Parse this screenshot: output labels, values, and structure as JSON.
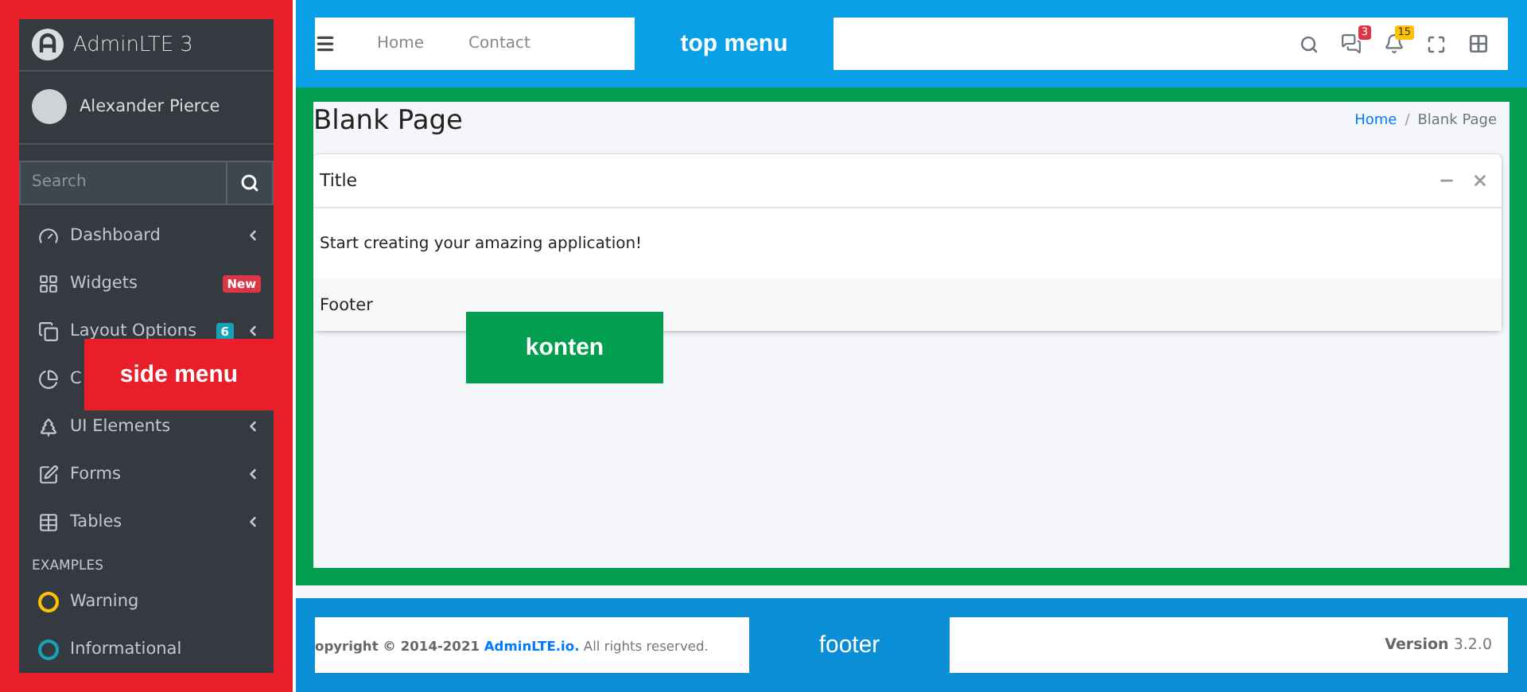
{
  "sidebar": {
    "brand": "AdminLTE 3",
    "user": "Alexander Pierce",
    "search": {
      "placeholder": "Search"
    },
    "items": [
      {
        "label": "Dashboard",
        "arrow": true
      },
      {
        "label": "Widgets",
        "arrow": false,
        "badge": {
          "text": "New",
          "color": "#dc3545"
        }
      },
      {
        "label": "Layout Options",
        "arrow": true,
        "badge": {
          "text": "6",
          "color": "#17a2b8"
        }
      },
      {
        "label": "C",
        "arrow": false
      },
      {
        "label": "UI Elements",
        "arrow": true
      },
      {
        "label": "Forms",
        "arrow": true
      },
      {
        "label": "Tables",
        "arrow": true
      }
    ],
    "header": "EXAMPLES",
    "examples": [
      {
        "label": "Warning",
        "color": "#ffc107"
      },
      {
        "label": "Informational",
        "color": "#17a2b8"
      }
    ]
  },
  "navbar": {
    "links": [
      "Home",
      "Contact"
    ],
    "messages_badge": "3",
    "notifications_badge": "15"
  },
  "content": {
    "title": "Blank Page",
    "breadcrumb": [
      {
        "label": "Home",
        "link": true
      },
      {
        "label": "Blank Page",
        "link": false
      }
    ],
    "separator": "/",
    "card": {
      "title": "Title",
      "body": "Start creating your amazing application!",
      "footer": "Footer"
    }
  },
  "footer": {
    "copyright": "opyright © 2014-2021",
    "link": "AdminLTE.io.",
    "rights": "All rights reserved.",
    "version": "**Version** 3.2.0"
  },
  "annotations": [
    {
      "kind": "side",
      "text": "side menu"
    },
    {
      "kind": "top",
      "text": "top menu"
    },
    {
      "kind": "content",
      "text": "konten"
    },
    {
      "kind": "footer",
      "text": "footer"
    }
  ]
}
